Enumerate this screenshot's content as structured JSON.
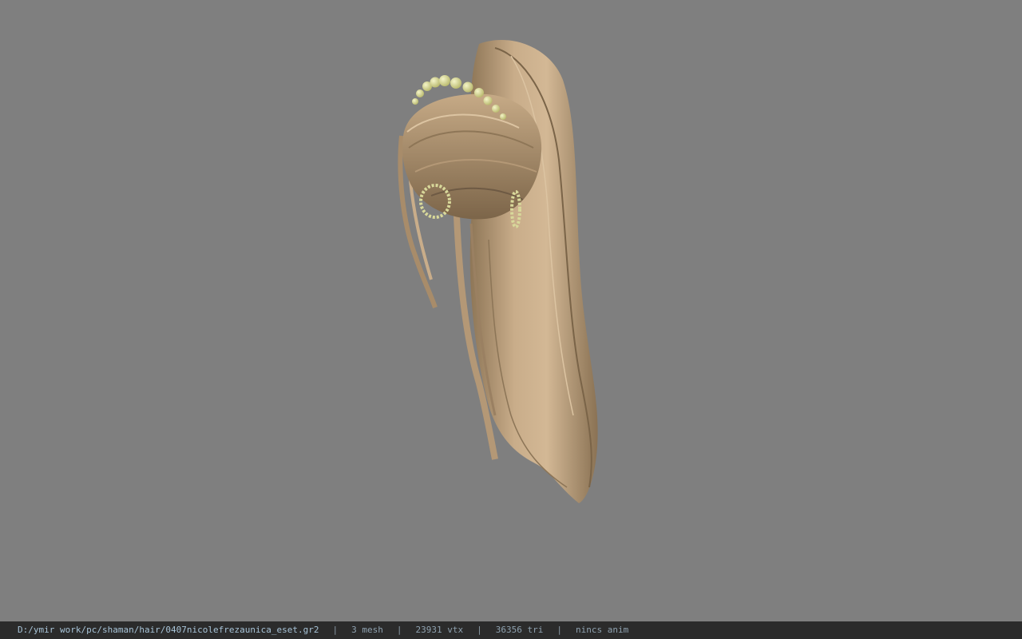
{
  "status_bar": {
    "file_path": "D:/ymir work/pc/shaman/hair/0407nicolefrezaunica_eset.gr2",
    "separator": "|",
    "mesh_count": "3 mesh",
    "vertex_count": "23931 vtx",
    "triangle_count": "36356 tri",
    "anim_status": "nincs anim"
  },
  "colors": {
    "background": "#7f7f7f",
    "status_bar_bg": "#2b2b2b",
    "status_text": "#9ab4c8",
    "hair_light": "#c9ad8a",
    "hair_mid": "#a88c6a",
    "hair_dark": "#6e5a44",
    "pearl": "#d8d89a"
  },
  "icons": {
    "model": "hair-3d-model"
  }
}
